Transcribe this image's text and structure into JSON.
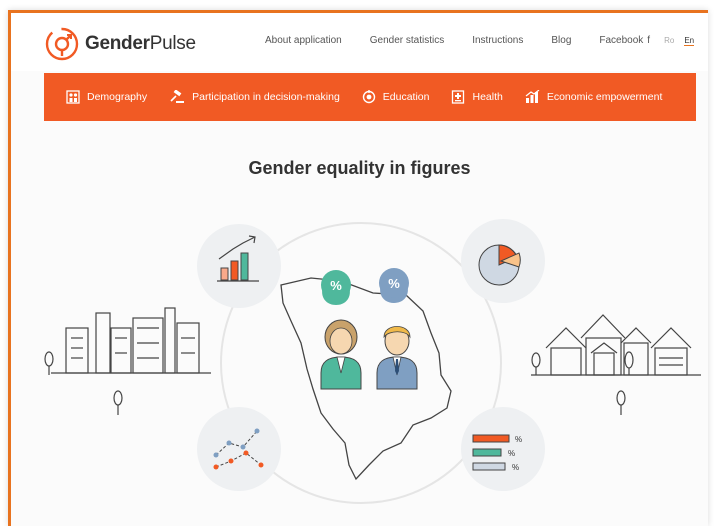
{
  "brand": {
    "name_bold": "Gender",
    "name_rest": "Pulse",
    "icon": "gender-pulse-logo"
  },
  "nav": {
    "items": [
      "About application",
      "Gender statistics",
      "Instructions",
      "Blog",
      "Facebook"
    ],
    "facebook_icon": "facebook-icon",
    "languages": [
      "Ro",
      "En"
    ],
    "active_language": "En"
  },
  "categories": [
    {
      "label": "Demography",
      "icon": "demography-icon"
    },
    {
      "label": "Participation in decision-making",
      "icon": "gavel-icon"
    },
    {
      "label": "Education",
      "icon": "education-icon"
    },
    {
      "label": "Health",
      "icon": "health-icon"
    },
    {
      "label": "Economic empowerment",
      "icon": "economy-icon"
    }
  ],
  "hero": {
    "title": "Gender equality in figures",
    "percent_marker": "%",
    "bar_labels": [
      "%",
      "%",
      "%"
    ]
  },
  "colors": {
    "accent": "#f15a24",
    "frame": "#e8731f",
    "teal": "#4fb89c",
    "blue": "#7f9fc2",
    "text": "#333333"
  }
}
